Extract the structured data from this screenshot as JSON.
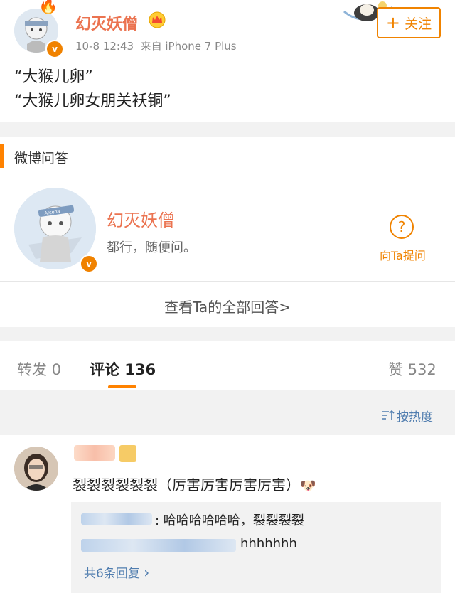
{
  "post": {
    "author": "幻灭妖僧",
    "time": "10-8 12:43",
    "source": "来自 iPhone 7 Plus",
    "follow_label": "关注",
    "follow_icon": "+",
    "lines": [
      "“大猴儿卵”",
      "“大猴儿卵女朋关袄铜”"
    ],
    "verified_mark": "v"
  },
  "qa": {
    "section_title": "微博问答",
    "author": "幻灭妖僧",
    "subtitle": "都行，随便问。",
    "ask_label": "向Ta提问",
    "ask_icon": "?",
    "view_all": "查看Ta的全部回答>",
    "avatar_headband_text": "Arsena"
  },
  "tabs": {
    "repost": "转发 0",
    "comments": "评论 136",
    "likes": "赞 532"
  },
  "sort": {
    "label": "按热度",
    "icon": "sort-icon"
  },
  "comments": [
    {
      "text": "裂裂裂裂裂裂（厉害厉害厉害厉害）",
      "emoji": "🐶",
      "replies": [
        {
          "text": ": 哈哈哈哈哈哈，裂裂裂裂"
        },
        {
          "text": "hhhhhhh"
        }
      ],
      "more_replies": "共6条回复",
      "more_icon": "›"
    }
  ],
  "colors": {
    "accent": "#f08300",
    "name": "#eb7350",
    "link": "#507daf"
  }
}
